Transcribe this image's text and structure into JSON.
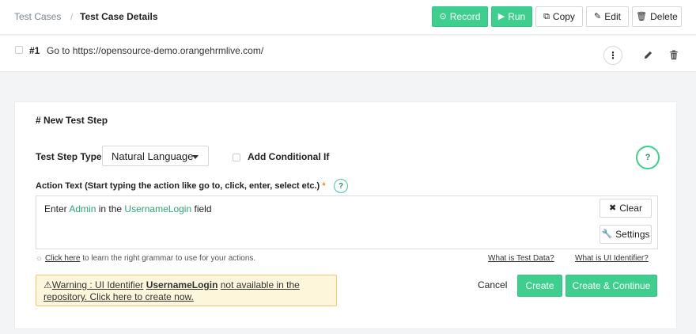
{
  "header": {
    "breadcrumb_root": "Test Cases",
    "breadcrumb_sep": "/",
    "breadcrumb_current": "Test Case Details",
    "buttons": {
      "record": "Record",
      "run": "Run",
      "copy": "Copy",
      "edit": "Edit",
      "delete": "Delete"
    }
  },
  "step_row": {
    "number": "#1",
    "action": "Go to",
    "url": "https://opensource-demo.orangehrmlive.com/"
  },
  "new_step": {
    "title": "# New Test Step",
    "type_label": "Test Step Type",
    "type_value": "Natural Language",
    "conditional_label": "Add Conditional If",
    "help_symbol": "?",
    "action_label": "Action Text (Start typing the action like go to, click, enter, select etc.)",
    "required_mark": "*",
    "editor": {
      "word1": "Enter",
      "token1": "Admin",
      "word2": "in the",
      "token2": "UsernameLogin",
      "word3": "field"
    },
    "clear_label": "Clear",
    "settings_label": "Settings",
    "hint_link": "Click here",
    "hint_text": "to learn the right grammar to use for your actions.",
    "test_data_link": "What is Test Data?",
    "ui_identifier_link": "What is UI Identifier?",
    "warning": {
      "prefix": "Warning : UI Identifier",
      "identifier": "UsernameLogin",
      "line1_rest": "not available in the",
      "line2": "repository. Click here to create now."
    },
    "cancel_label": "Cancel",
    "create_label": "Create",
    "create_continue_label": "Create & Continue"
  },
  "colors": {
    "accent_green": "#3ecf8e",
    "warning_bg": "#fdf6da",
    "warning_border": "#f1c96d"
  }
}
